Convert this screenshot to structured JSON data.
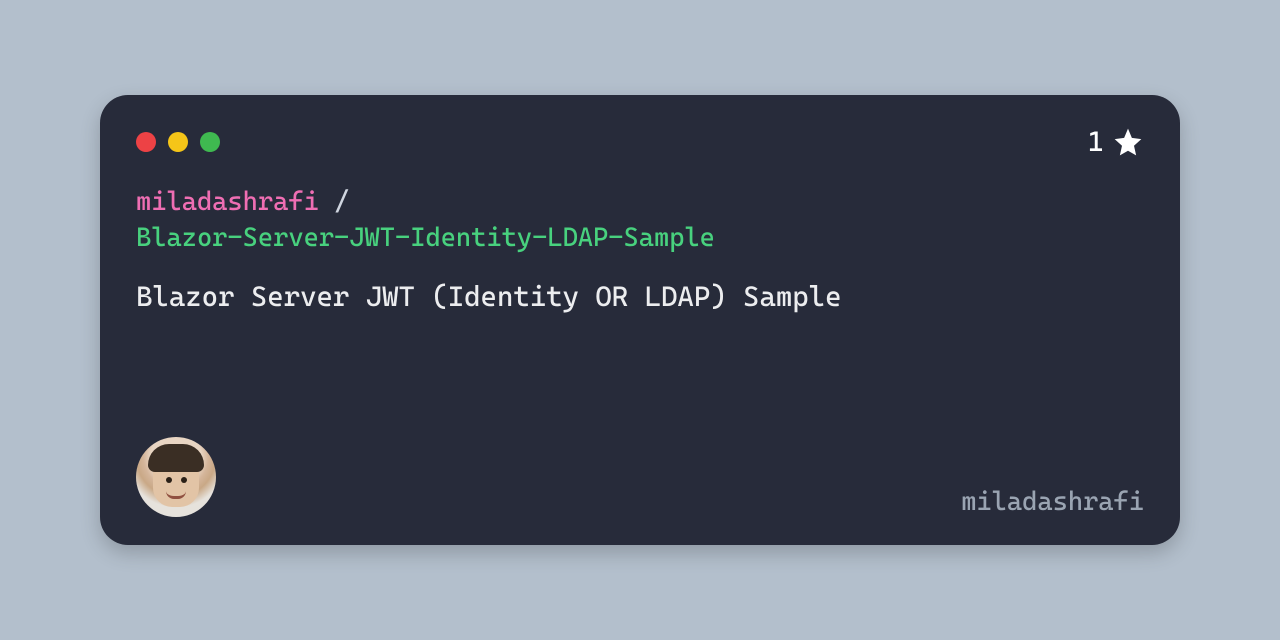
{
  "repo": {
    "owner": "miladashrafi",
    "separator": " /",
    "name": "Blazor-Server-JWT-Identity-LDAP-Sample",
    "description": "Blazor Server JWT (Identity OR LDAP) Sample"
  },
  "stars": {
    "count": "1"
  },
  "footer": {
    "username": "miladashrafi"
  },
  "colors": {
    "background": "#b3bfcc",
    "card": "#272b3a",
    "owner": "#ef6eb3",
    "name": "#48d17e"
  }
}
